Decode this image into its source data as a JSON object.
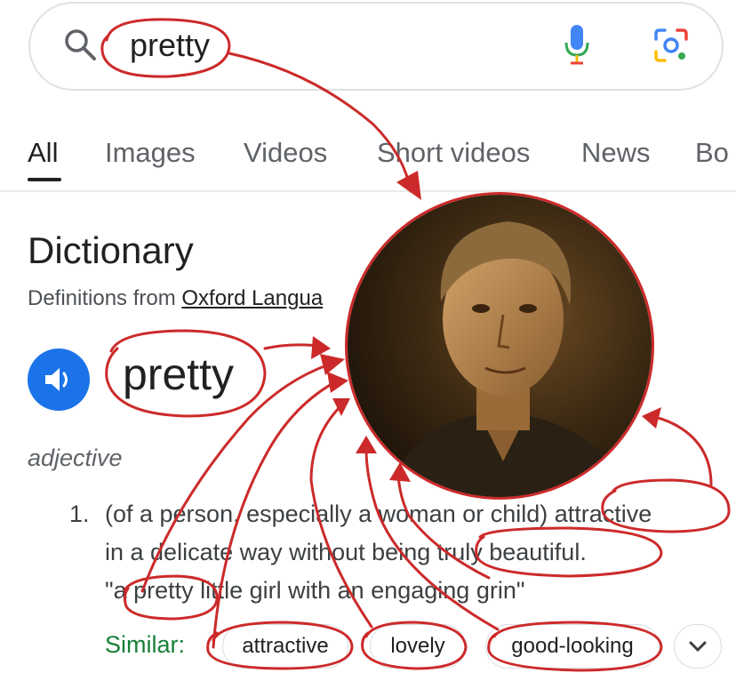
{
  "search": {
    "query": "pretty"
  },
  "tabs": [
    {
      "label": "All",
      "active": true
    },
    {
      "label": "Images"
    },
    {
      "label": "Videos"
    },
    {
      "label": "Short videos"
    },
    {
      "label": "News"
    },
    {
      "label": "Bo"
    }
  ],
  "dictionary": {
    "title": "Dictionary",
    "source_prefix": "Definitions from ",
    "source_link": "Oxford Langua",
    "headword": "pretty",
    "part_of_speech": "adjective",
    "definition_number": "1.",
    "definition_lines": [
      "(of a person, especially a woman or child) attractive",
      "in a delicate way without being truly beautiful.",
      "\"a pretty little girl with an engaging grin\""
    ],
    "similar_label": "Similar:",
    "similar": [
      "attractive",
      "lovely",
      "good-looking"
    ]
  },
  "colors": {
    "annotation_red": "#cc2a2a",
    "google_blue": "#1a73e8",
    "similar_green": "#188038"
  },
  "icons": [
    "search-icon",
    "mic-icon",
    "lens-icon",
    "speaker-icon",
    "chevron-down-icon"
  ]
}
